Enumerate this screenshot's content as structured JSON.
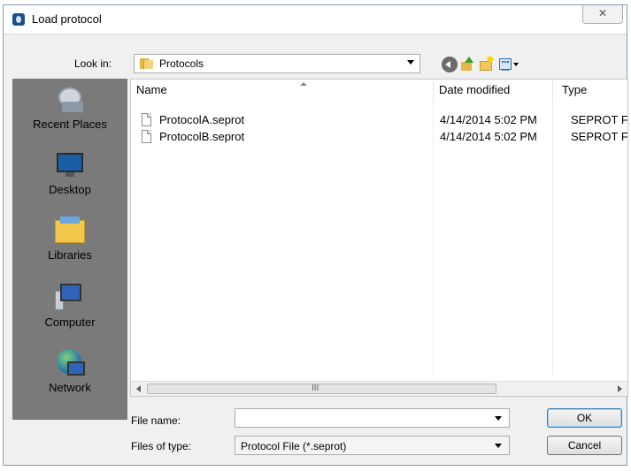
{
  "window": {
    "title": "Load protocol",
    "close_glyph": "✕"
  },
  "look_in": {
    "label": "Look in:",
    "value": "Protocols"
  },
  "toolbar_icons": [
    "back-icon",
    "up-folder-icon",
    "new-folder-icon",
    "view-menu-icon"
  ],
  "places": [
    {
      "label": "Recent Places",
      "icon": "recent-places-icon"
    },
    {
      "label": "Desktop",
      "icon": "desktop-icon"
    },
    {
      "label": "Libraries",
      "icon": "libraries-icon"
    },
    {
      "label": "Computer",
      "icon": "computer-icon"
    },
    {
      "label": "Network",
      "icon": "network-icon"
    }
  ],
  "columns": {
    "name": "Name",
    "date": "Date modified",
    "type": "Type"
  },
  "files": [
    {
      "name": "ProtocolA.seprot",
      "date": "4/14/2014 5:02 PM",
      "type": "SEPROT F"
    },
    {
      "name": "ProtocolB.seprot",
      "date": "4/14/2014 5:02 PM",
      "type": "SEPROT F"
    }
  ],
  "scrollbar": {
    "grip": "III"
  },
  "file_name": {
    "label": "File name:",
    "value": ""
  },
  "file_type": {
    "label": "Files of type:",
    "value": "Protocol File (*.seprot)"
  },
  "buttons": {
    "ok": "OK",
    "cancel": "Cancel"
  },
  "colors": {
    "places_bg": "#7a7a7a",
    "dialog_bg": "#f0f0f0"
  }
}
